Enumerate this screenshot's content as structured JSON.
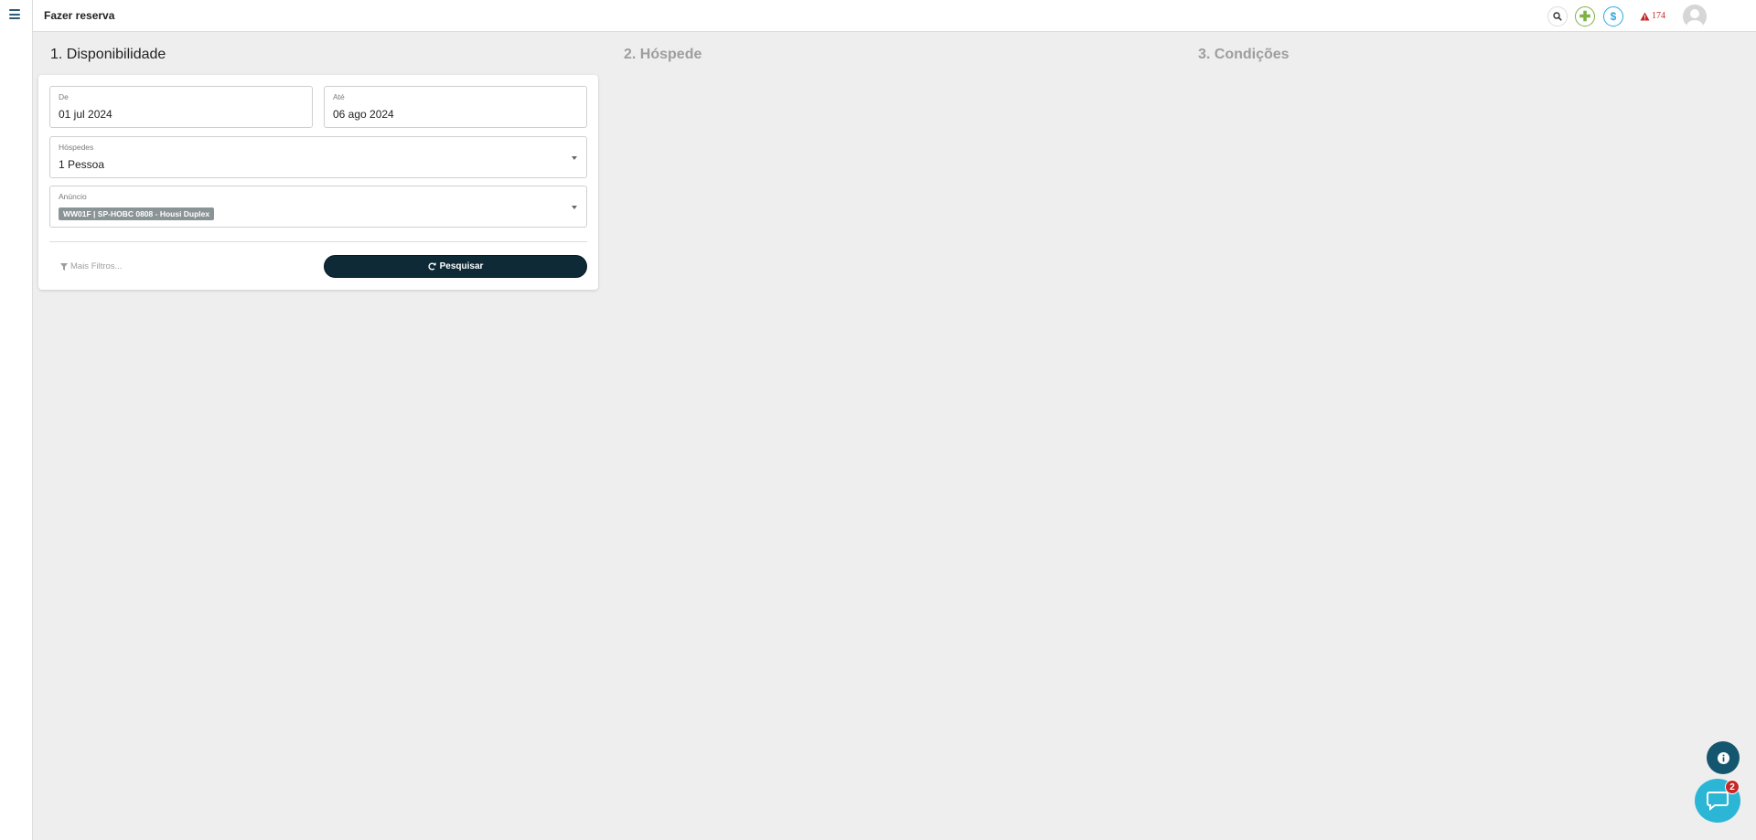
{
  "header": {
    "title": "Fazer reserva",
    "alert_count": "174",
    "colors": {
      "add": "#7cb342",
      "money": "#29a8e0",
      "alert": "#c62828"
    }
  },
  "steps": [
    {
      "label": "1. Disponibilidade"
    },
    {
      "label": "2. Hóspede"
    },
    {
      "label": "3. Condições"
    }
  ],
  "form": {
    "from": {
      "label": "De",
      "value": "01 jul 2024"
    },
    "to": {
      "label": "Até",
      "value": "06 ago 2024"
    },
    "guests": {
      "label": "Hóspedes",
      "value": "1 Pessoa"
    },
    "listing": {
      "label": "Anúncio",
      "chip": "WW01F | SP-HOBC 0808 - Housi Duplex"
    },
    "more_filters": "Mais Filtros...",
    "search_button": "Pesquisar"
  },
  "widgets": {
    "chat_badge": "2"
  },
  "theme": {
    "primary_dark": "#0d2a36",
    "chat": "#2bb6d6",
    "info": "#15566f"
  }
}
